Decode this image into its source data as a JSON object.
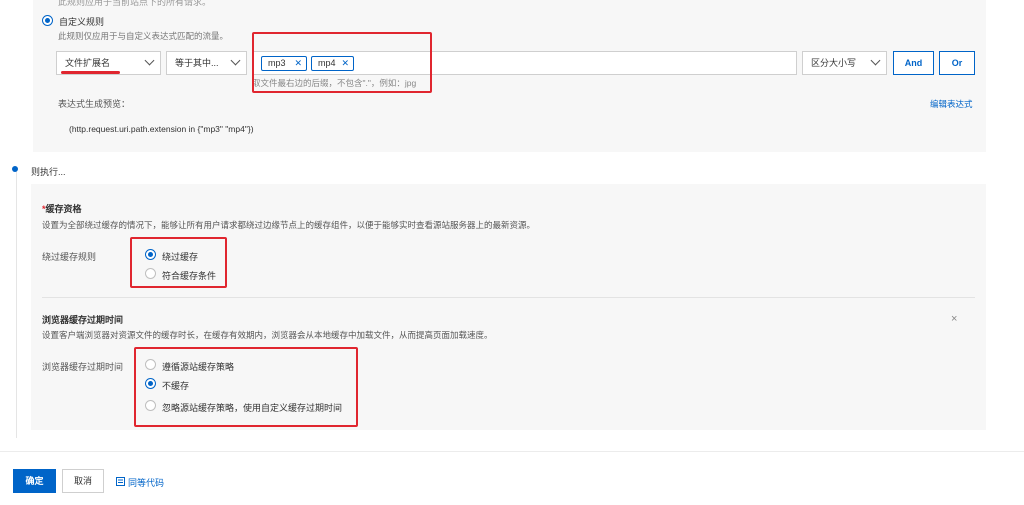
{
  "rule_condition": {
    "top_clipped_text": "此规则应用于当前站点下的所有请求。",
    "custom_rule_label": "自定义规则",
    "custom_rule_desc": "此规则仅应用于与自定义表达式匹配的流量。",
    "field_select": "文件扩展名",
    "operator_select": "等于其中...",
    "tags": [
      "mp3",
      "mp4"
    ],
    "value_hint": "取文件最右边的后缀，不包含\".\"，例如：jpg",
    "case_select": "区分大小写",
    "and_label": "And",
    "or_label": "Or",
    "preview_label": "表达式生成预览：",
    "edit_expression_link": "编辑表达式",
    "expression": "(http.request.uri.path.extension in {\"mp3\" \"mp4\"})"
  },
  "then_label": "则执行...",
  "cache_eligibility": {
    "title": "缓存资格",
    "required_mark": "*",
    "desc": "设置为全部绕过缓存的情况下，能够让所有用户请求都绕过边缘节点上的缓存组件，以便于能够实时查看源站服务器上的最新资源。",
    "field_label": "绕过缓存规则",
    "options": [
      {
        "label": "绕过缓存",
        "selected": true
      },
      {
        "label": "符合缓存条件",
        "selected": false
      }
    ]
  },
  "browser_cache": {
    "title": "浏览器缓存过期时间",
    "desc": "设置客户端浏览器对资源文件的缓存时长，在缓存有效期内，浏览器会从本地缓存中加载文件，从而提高页面加载速度。",
    "field_label": "浏览器缓存过期时间",
    "close_symbol": "×",
    "options": [
      {
        "label": "遵循源站缓存策略",
        "selected": false
      },
      {
        "label": "不缓存",
        "selected": true
      },
      {
        "label": "忽略源站缓存策略，使用自定义缓存过期时间",
        "selected": false
      }
    ]
  },
  "footer": {
    "confirm_label": "确定",
    "cancel_label": "取消",
    "equivalent_code_label": "同等代码"
  },
  "colors": {
    "primary": "#0064c8",
    "annotation_red": "#e0262f",
    "panel_bg": "#f7f7f7"
  }
}
